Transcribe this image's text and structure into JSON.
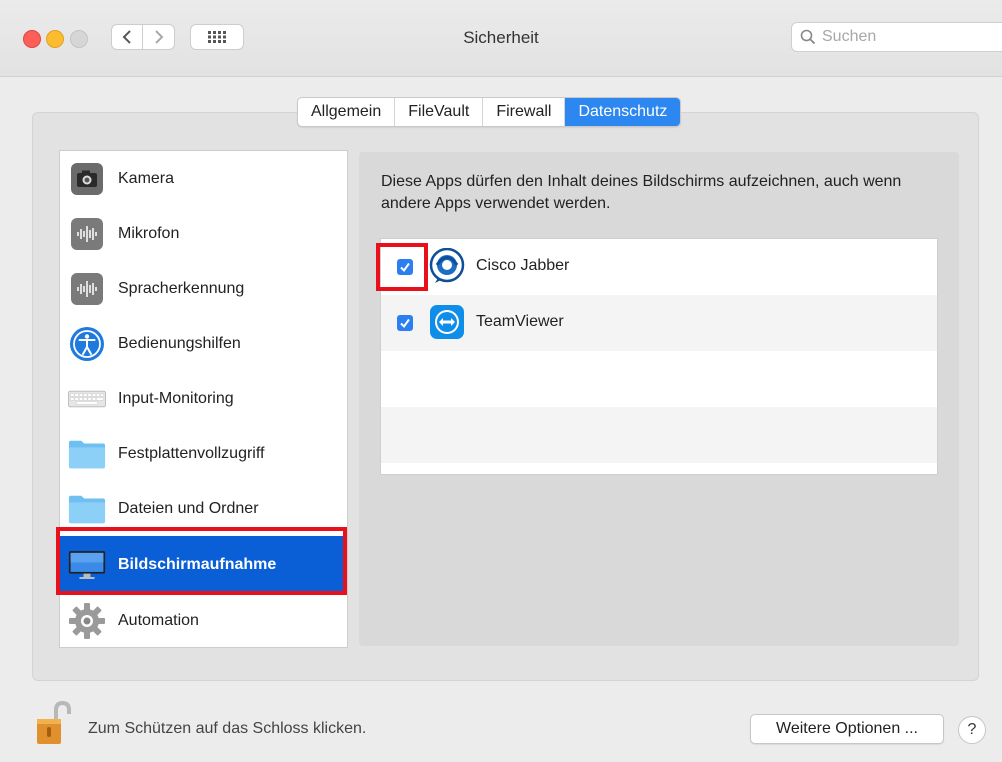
{
  "window": {
    "title": "Sicherheit",
    "search_placeholder": "Suchen"
  },
  "tabs": [
    {
      "label": "Allgemein",
      "active": false
    },
    {
      "label": "FileVault",
      "active": false
    },
    {
      "label": "Firewall",
      "active": false
    },
    {
      "label": "Datenschutz",
      "active": true
    }
  ],
  "categories": [
    {
      "label": "Kamera",
      "icon": "camera-icon"
    },
    {
      "label": "Mikrofon",
      "icon": "microphone-icon"
    },
    {
      "label": "Spracherkennung",
      "icon": "speech-recognition-icon"
    },
    {
      "label": "Bedienungshilfen",
      "icon": "accessibility-icon"
    },
    {
      "label": "Input-Monitoring",
      "icon": "keyboard-icon"
    },
    {
      "label": "Festplattenvollzugriff",
      "icon": "folder-icon"
    },
    {
      "label": "Dateien und Ordner",
      "icon": "folder-icon"
    },
    {
      "label": "Bildschirmaufnahme",
      "icon": "display-icon",
      "selected": true
    },
    {
      "label": "Automation",
      "icon": "gear-icon"
    }
  ],
  "detail": {
    "description": "Diese Apps dürfen den Inhalt deines Bildschirms aufzeichnen, auch wenn andere Apps verwendet werden.",
    "apps": [
      {
        "name": "Cisco Jabber",
        "checked": true,
        "icon": "cisco-jabber-icon"
      },
      {
        "name": "TeamViewer",
        "checked": true,
        "icon": "teamviewer-icon"
      }
    ]
  },
  "footer": {
    "lock_hint": "Zum Schützen auf das Schloss klicken.",
    "more_options_label": "Weitere Optionen ...",
    "help_label": "?"
  },
  "colors": {
    "accent": "#2c87f0",
    "selection": "#0a5fd6",
    "highlight_box": "#e8101a"
  }
}
